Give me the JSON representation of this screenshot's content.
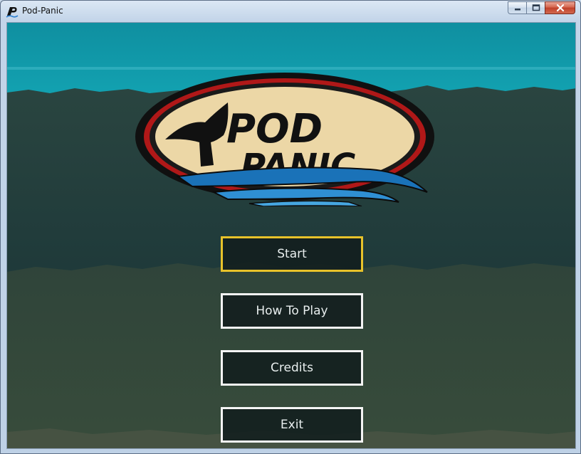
{
  "window": {
    "title": "Pod-Panic",
    "minimize_icon": "minimize-icon",
    "maximize_icon": "maximize-icon",
    "close_icon": "close-icon"
  },
  "logo": {
    "word1": "POD",
    "word2": "PANIC",
    "icon": "whale-tail-icon"
  },
  "menu": {
    "selected_index": 0,
    "highlight_color": "#e8c22a",
    "items": [
      {
        "label": "Start"
      },
      {
        "label": "How To Play"
      },
      {
        "label": "Credits"
      },
      {
        "label": "Exit"
      }
    ]
  },
  "colors": {
    "sky": "#11a0b0",
    "deep_water": "#1e3a3a",
    "seabed": "#344838"
  }
}
